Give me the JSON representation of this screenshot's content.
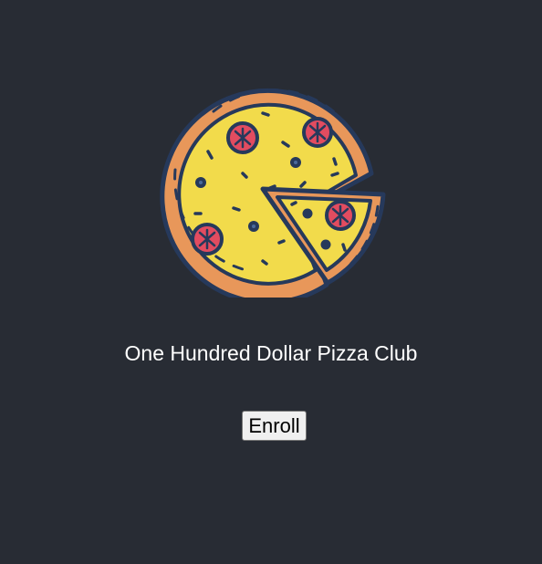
{
  "app": {
    "logo_icon": "pizza-icon",
    "title": "One Hundred Dollar Pizza Club",
    "enroll_label": "Enroll"
  },
  "colors": {
    "background": "#282c34",
    "title_text": "#ffffff",
    "button_background": "#f0f0f0",
    "pizza_crust": "#e8975a",
    "pizza_cheese": "#f2db4b",
    "pepperoni": "#e24c60",
    "outline": "#26395b"
  }
}
